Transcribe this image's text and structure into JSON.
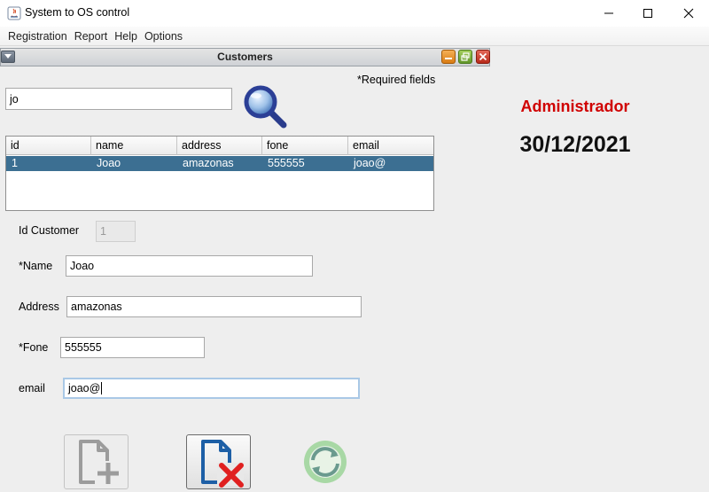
{
  "window": {
    "title": "System to OS control"
  },
  "menu": [
    "Registration",
    "Report",
    "Help",
    "Options"
  ],
  "frame": {
    "title": "Customers",
    "required_note": "*Required fields"
  },
  "search": {
    "value": "jo"
  },
  "table": {
    "headers": [
      "id",
      "name",
      "address",
      "fone",
      "email"
    ],
    "rows": [
      [
        "1",
        "Joao",
        "amazonas",
        "555555",
        "joao@"
      ]
    ]
  },
  "form": {
    "id_label": "Id Customer",
    "id_value": "1",
    "name_label": "*Name",
    "name_value": "Joao",
    "address_label": "Address",
    "address_value": "amazonas",
    "fone_label": "*Fone",
    "fone_value": "555555",
    "email_label": "email",
    "email_value": "joao@"
  },
  "status": {
    "user": "Administrador",
    "date": "30/12/2021"
  },
  "colors": {
    "user_label": "#d00000",
    "selected_row": "#3c6f92"
  },
  "icons": {
    "search": "magnifier-icon",
    "add": "add-document-icon",
    "delete": "delete-document-icon",
    "refresh": "refresh-icon"
  }
}
